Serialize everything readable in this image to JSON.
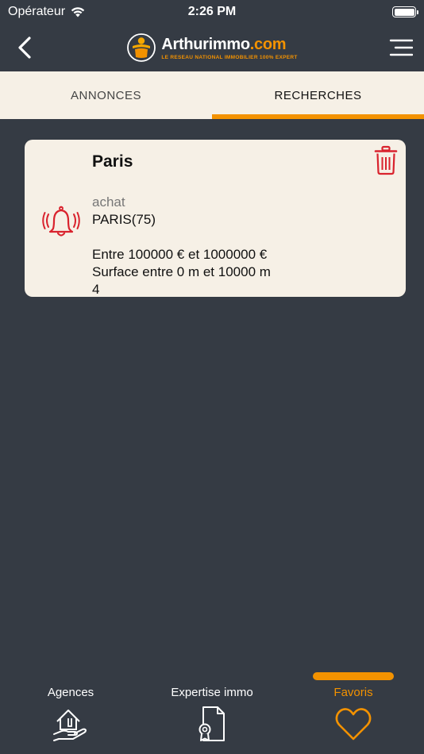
{
  "status_bar": {
    "carrier": "Opérateur",
    "time": "2:26 PM"
  },
  "header": {
    "logo_main": "Arthurimmo",
    "logo_domain": ".com",
    "logo_tagline": "LE RESEAU NATIONAL IMMOBILIER 100% EXPERT"
  },
  "tabs": [
    {
      "label": "ANNONCES",
      "active": false
    },
    {
      "label": "RECHERCHES",
      "active": true
    }
  ],
  "search_card": {
    "title": "Paris",
    "type": "achat",
    "location": "PARIS(75)",
    "price_range": "Entre 100000 € et 1000000 €",
    "surface_range": "Surface entre 0 m et 10000 m",
    "surface_exponent": "4"
  },
  "bottom_nav": [
    {
      "label": "Agences",
      "icon": "agency-house-icon",
      "active": false
    },
    {
      "label": "Expertise immo",
      "icon": "certified-document-icon",
      "active": false
    },
    {
      "label": "Favoris",
      "icon": "heart-icon",
      "active": true
    }
  ],
  "colors": {
    "background": "#353b44",
    "accent": "#f39200",
    "card": "#f6f0e6",
    "alert_red": "#d9232e"
  }
}
